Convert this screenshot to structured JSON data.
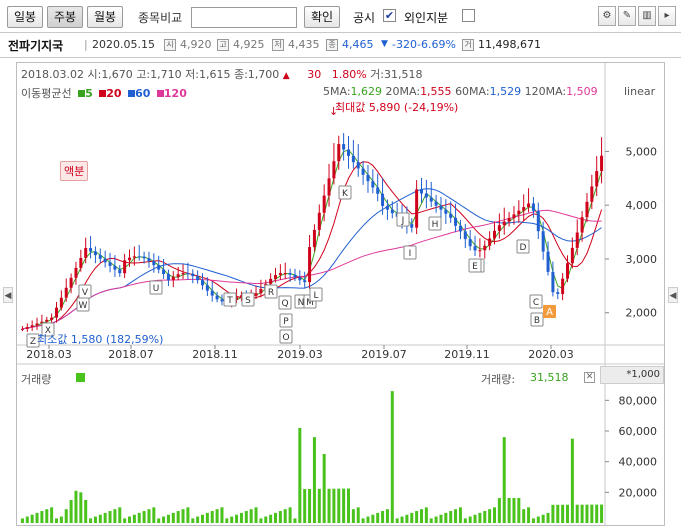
{
  "toolbar": {
    "period_buttons": [
      "일봉",
      "주봉",
      "월봉"
    ],
    "active_period": "주봉",
    "compare_label": "종목비교",
    "compare_value": "",
    "confirm_label": "확인",
    "disclosure_label": "공시",
    "disclosure_checked": true,
    "foreign_label": "외인지분",
    "foreign_checked": false
  },
  "info": {
    "name": "전파기지국",
    "date": "2020.05.15",
    "open": "4,920",
    "high": "4,925",
    "low": "4,435",
    "close": "4,465",
    "change": "-320",
    "change_pct": "-6.69%",
    "volume": "11,498,671"
  },
  "ohlc_line": {
    "date": "2018.03.02",
    "open_label": "시:",
    "open": "1,670",
    "high_label": "고:",
    "high": "1,710",
    "low_label": "저:",
    "low": "1,615",
    "close_label": "종:",
    "close": "1,700",
    "arrow": "▲",
    "change": "30",
    "change_pct": "1.80%",
    "vol_label": "거:",
    "volume": "31,518"
  },
  "ma_legend": {
    "label": "이동평균선",
    "items": [
      {
        "period": "5",
        "color": "#39a31f"
      },
      {
        "period": "20",
        "color": "#d0021b"
      },
      {
        "period": "60",
        "color": "#1f5fd1"
      },
      {
        "period": "120",
        "color": "#e0389a"
      }
    ],
    "values_text": [
      {
        "label": "5MA:",
        "value": "1,629",
        "color": "#39a31f"
      },
      {
        "label": "20MA:",
        "value": "1,555",
        "color": "#d0021b"
      },
      {
        "label": "60MA:",
        "value": "1,529",
        "color": "#1f5fd1"
      },
      {
        "label": "120MA:",
        "value": "1,509",
        "color": "#e0389a"
      }
    ],
    "scale": "linear"
  },
  "annotations": {
    "max_label": "최대값 5,890 (-24,19%)",
    "min_label": "최소값 1,580 (182,59%)",
    "split_label": "액분",
    "event_letters": [
      "Z",
      "X",
      "W",
      "V",
      "U",
      "T",
      "S",
      "R",
      "Q",
      "P",
      "O",
      "N",
      "M",
      "L",
      "K",
      "J",
      "I",
      "H",
      "G",
      "F",
      "E",
      "D",
      "C",
      "B",
      "A"
    ]
  },
  "price_axis": [
    "5,000",
    "4,000",
    "3,000",
    "2,000"
  ],
  "time_axis": [
    "2018.03",
    "2018.07",
    "2018.11",
    "2019.03",
    "2019.07",
    "2019.11",
    "2020.03"
  ],
  "volume_panel": {
    "title": "거래량",
    "value_label": "거래량:",
    "value": "31,518",
    "unit": "*1,000",
    "axis": [
      "80,000",
      "60,000",
      "40,000",
      "20,000"
    ]
  },
  "colors": {
    "up": "#d0021b",
    "down": "#1f5fd1",
    "ma5": "#39a31f",
    "ma20": "#d0021b",
    "ma60": "#1f5fd1",
    "ma120": "#e0389a",
    "volume": "#49c21b"
  }
}
